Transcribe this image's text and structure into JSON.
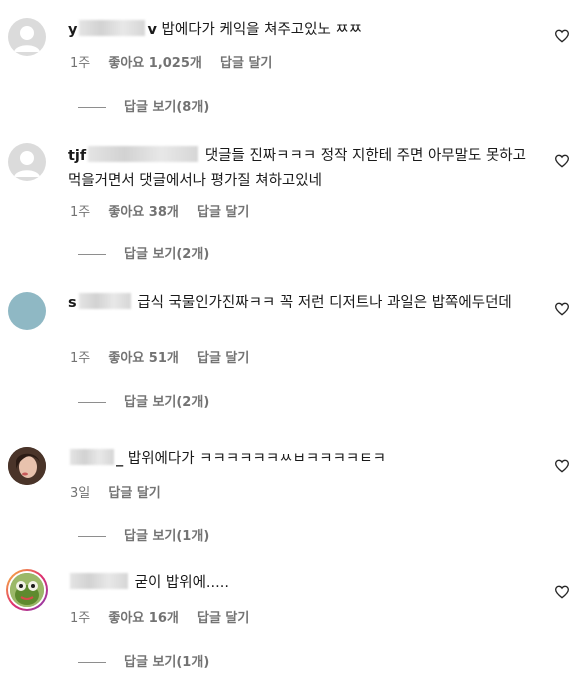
{
  "comments": [
    {
      "username_visible_start": "y",
      "username_visible_end": "v",
      "text": "밥에다가 케익을 쳐주고있노 ㅉㅉ",
      "time": "1주",
      "likes": "좋아요 1,025개",
      "reply_label": "답글 달기",
      "view_replies": "답글 보기(8개)"
    },
    {
      "username_visible_start": "tjf",
      "username_visible_end": "",
      "text": "댓글들 진짜ㅋㅋㅋ 정작 지한테 주면 아무말도 못하고 먹을거면서 댓글에서나 평가질 쳐하고있네",
      "time": "1주",
      "likes": "좋아요 38개",
      "reply_label": "답글 달기",
      "view_replies": "답글 보기(2개)"
    },
    {
      "username_visible_start": "s",
      "username_visible_end": "",
      "text": "급식 국물인가진짜ㅋㅋ 꼭 저런 디저트나 과일은 밥쪽에두던데",
      "time": "1주",
      "likes": "좋아요 51개",
      "reply_label": "답글 달기",
      "view_replies": "답글 보기(2개)"
    },
    {
      "username_visible_start": "",
      "username_visible_end": "_",
      "text": "밥위에다가 ㅋㅋㅋㅋㅋㅋㅆㅂㅋㅋㅋㅋㅌㅋ",
      "time": "3일",
      "likes": "",
      "reply_label": "답글 달기",
      "view_replies": "답글 보기(1개)"
    },
    {
      "username_visible_start": "",
      "username_visible_end": "",
      "text": "굳이 밥위에.....",
      "time": "1주",
      "likes": "좋아요 16개",
      "reply_label": "답글 달기",
      "view_replies": "답글 보기(1개)"
    }
  ],
  "icons": {
    "like": "heart-outline-icon",
    "avatar_default": "default-avatar-icon"
  },
  "colors": {
    "text": "#1a1a1a",
    "meta": "#737373",
    "avatar_default": "#dbdbdb",
    "avatar_teal": "#8fb8c4"
  }
}
